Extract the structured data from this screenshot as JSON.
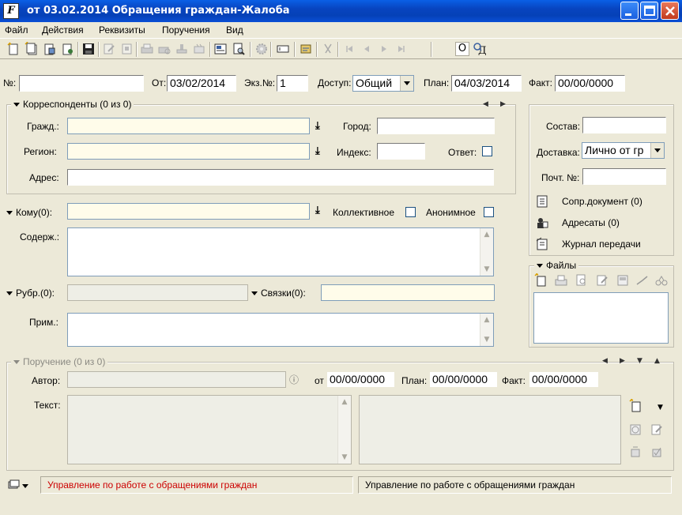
{
  "window": {
    "title": "от 03.02.2014 Обращения граждан-Жалоба"
  },
  "menu": [
    "Файл",
    "Действия",
    "Реквизиты",
    "Поручения",
    "Вид"
  ],
  "toolbar": {
    "letter_o": "О"
  },
  "header": {
    "num_label": "№:",
    "num_value": "",
    "from_label": "От:",
    "from_value": "03/02/2014",
    "copy_label": "Экз.№:",
    "copy_value": "1",
    "access_label": "Доступ:",
    "access_value": "Общий",
    "plan_label": "План:",
    "plan_value": "04/03/2014",
    "fact_label": "Факт:",
    "fact_value": "00/00/0000"
  },
  "correspondents": {
    "legend": "Корреспонденты (0 из 0)",
    "citizen_label": "Гражд.:",
    "city_label": "Город:",
    "region_label": "Регион:",
    "index_label": "Индекс:",
    "answer_label": "Ответ:",
    "address_label": "Адрес:"
  },
  "right_panel": {
    "composition_label": "Состав:",
    "delivery_label": "Доставка:",
    "delivery_value": "Лично от гр",
    "postal_label": "Почт. №:",
    "links": [
      "Сопр.документ (0)",
      "Адресаты (0)",
      "Журнал передачи"
    ],
    "files_label": "Файлы"
  },
  "body": {
    "to_label": "Кому(0):",
    "collective_label": "Коллективное",
    "anonymous_label": "Анонимное",
    "content_label": "Содерж.:",
    "rubric_label": "Рубр.(0):",
    "links_label": "Связки(0):",
    "note_label": "Прим.:"
  },
  "assignment": {
    "legend": "Поручение (0 из 0)",
    "author_label": "Автор:",
    "from_label": "от",
    "from_value": "00/00/0000",
    "plan_label": "План:",
    "plan_value": "00/00/0000",
    "fact_label": "Факт:",
    "fact_value": "00/00/0000",
    "text_label": "Текст:"
  },
  "status": {
    "left": "Управление по работе с обращениями граждан",
    "right": "Управление по работе с обращениями граждан",
    "left_color": "#cc0000"
  }
}
